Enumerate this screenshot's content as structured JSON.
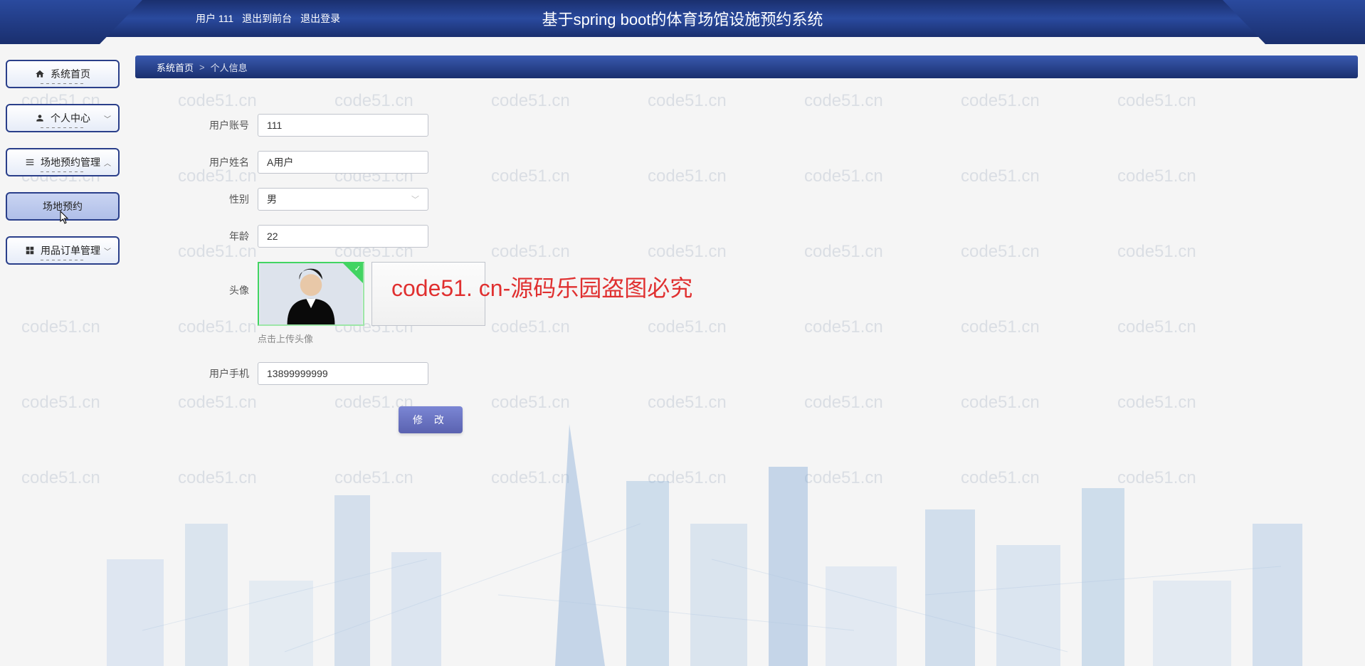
{
  "header": {
    "user_label": "用户 111",
    "exit_front": "退出到前台",
    "logout": "退出登录",
    "app_title": "基于spring boot的体育场馆设施预约系统"
  },
  "sidebar": {
    "items": [
      {
        "label": "系统首页",
        "icon": "home",
        "expandable": false,
        "active": false
      },
      {
        "label": "个人中心",
        "icon": "person",
        "expandable": true,
        "active": false
      },
      {
        "label": "场地预约管理",
        "icon": "list",
        "expandable": true,
        "active": false
      },
      {
        "label": "场地预约",
        "icon": "",
        "expandable": false,
        "active": true
      },
      {
        "label": "用品订单管理",
        "icon": "grid",
        "expandable": true,
        "active": false
      }
    ]
  },
  "breadcrumb": {
    "root": "系统首页",
    "sep": ">",
    "current": "个人信息"
  },
  "form": {
    "fields": {
      "account": {
        "label": "用户账号",
        "value": "111"
      },
      "name": {
        "label": "用户姓名",
        "value": "A用户"
      },
      "gender": {
        "label": "性别",
        "value": "男"
      },
      "age": {
        "label": "年龄",
        "value": "22"
      },
      "avatar": {
        "label": "头像"
      },
      "phone": {
        "label": "用户手机",
        "value": "13899999999"
      }
    },
    "avatar_hint": "点击上传头像",
    "submit": "修 改"
  },
  "watermark_text": "code51.cn",
  "piracy_text": "code51. cn-源码乐园盗图必究"
}
